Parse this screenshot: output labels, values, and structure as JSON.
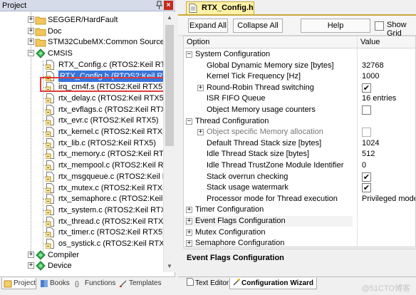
{
  "project_pane": {
    "title": "Project",
    "tree": [
      {
        "label": "SEGGER/HardFault",
        "kind": "folder",
        "expander": "+"
      },
      {
        "label": "Doc",
        "kind": "folder",
        "expander": "+"
      },
      {
        "label": "STM32CubeMX:Common Sources",
        "kind": "folder",
        "expander": "+"
      },
      {
        "label": "CMSIS",
        "kind": "component",
        "expander": "−"
      },
      {
        "label": "RTX_Config.c (RTOS2:Keil RTX5)",
        "kind": "file"
      },
      {
        "label": "RTX_Config.h (RTOS2:Keil RTX5)",
        "kind": "file",
        "selected": true
      },
      {
        "label": "irq_cm4f.s (RTOS2:Keil RTX5)",
        "kind": "file"
      },
      {
        "label": "rtx_delay.c (RTOS2:Keil RTX5)",
        "kind": "file"
      },
      {
        "label": "rtx_evflags.c (RTOS2:Keil RTX5)",
        "kind": "file"
      },
      {
        "label": "rtx_evr.c (RTOS2:Keil RTX5)",
        "kind": "file"
      },
      {
        "label": "rtx_kernel.c (RTOS2:Keil RTX5)",
        "kind": "file"
      },
      {
        "label": "rtx_lib.c (RTOS2:Keil RTX5)",
        "kind": "file"
      },
      {
        "label": "rtx_memory.c (RTOS2:Keil RTX5)",
        "kind": "file"
      },
      {
        "label": "rtx_mempool.c (RTOS2:Keil RTX5)",
        "kind": "file"
      },
      {
        "label": "rtx_msgqueue.c (RTOS2:Keil RTX5)",
        "kind": "file"
      },
      {
        "label": "rtx_mutex.c (RTOS2:Keil RTX5)",
        "kind": "file"
      },
      {
        "label": "rtx_semaphore.c (RTOS2:Keil RTX5)",
        "kind": "file"
      },
      {
        "label": "rtx_system.c (RTOS2:Keil RTX5)",
        "kind": "file"
      },
      {
        "label": "rtx_thread.c (RTOS2:Keil RTX5)",
        "kind": "file"
      },
      {
        "label": "rtx_timer.c (RTOS2:Keil RTX5)",
        "kind": "file"
      },
      {
        "label": "os_systick.c (RTOS2:Keil RTX5)",
        "kind": "file"
      },
      {
        "label": "Compiler",
        "kind": "component",
        "expander": "+"
      },
      {
        "label": "Device",
        "kind": "component",
        "expander": "+"
      }
    ],
    "bottom_tabs": [
      "Project",
      "Books",
      "{} Functions",
      "Templates"
    ],
    "bottom_tabs_display": [
      "Project",
      "Books",
      "Functions",
      "Templates"
    ]
  },
  "editor": {
    "file_tab": "RTX_Config.h",
    "toolbar": {
      "expand_all": "Expand All",
      "collapse_all": "Collapse All",
      "help": "Help",
      "show_grid": "Show Grid"
    },
    "columns": {
      "option": "Option",
      "value": "Value"
    },
    "rows": [
      {
        "label": "System Configuration",
        "level": 0,
        "expander": "−"
      },
      {
        "label": "Global Dynamic Memory size [bytes]",
        "level": 1,
        "value": "32768"
      },
      {
        "label": "Kernel Tick Frequency [Hz]",
        "level": 1,
        "value": "1000"
      },
      {
        "label": "Round-Robin Thread switching",
        "level": 1,
        "expander": "+",
        "check": true
      },
      {
        "label": "ISR FIFO Queue",
        "level": 1,
        "value": "16 entries"
      },
      {
        "label": "Object Memory usage counters",
        "level": 1,
        "check": false
      },
      {
        "label": "Thread Configuration",
        "level": 0,
        "expander": "−"
      },
      {
        "label": "Object specific Memory allocation",
        "level": 1,
        "expander": "+",
        "check": false,
        "dim": true
      },
      {
        "label": "Default Thread Stack size [bytes]",
        "level": 1,
        "value": "1024"
      },
      {
        "label": "Idle Thread Stack size [bytes]",
        "level": 1,
        "value": "512"
      },
      {
        "label": "Idle Thread TrustZone Module Identifier",
        "level": 1,
        "value": "0"
      },
      {
        "label": "Stack overrun checking",
        "level": 1,
        "check": true
      },
      {
        "label": "Stack usage watermark",
        "level": 1,
        "check": true
      },
      {
        "label": "Processor mode for Thread execution",
        "level": 1,
        "value": "Privileged mode"
      },
      {
        "label": "Timer Configuration",
        "level": 0,
        "expander": "+"
      },
      {
        "label": "Event Flags Configuration",
        "level": 0,
        "expander": "+",
        "highlight": true
      },
      {
        "label": "Mutex Configuration",
        "level": 0,
        "expander": "+"
      },
      {
        "label": "Semaphore Configuration",
        "level": 0,
        "expander": "+"
      }
    ],
    "description": "Event Flags Configuration",
    "bottom_tabs": [
      "Text Editor",
      "Configuration Wizard"
    ]
  },
  "watermark": "@51CTO博客",
  "colors": {
    "selection": "#3874d8",
    "highlight_box": "#e23a3a",
    "file_tab": "#fff2a8",
    "cmsis_diamond": "#22a33a"
  }
}
